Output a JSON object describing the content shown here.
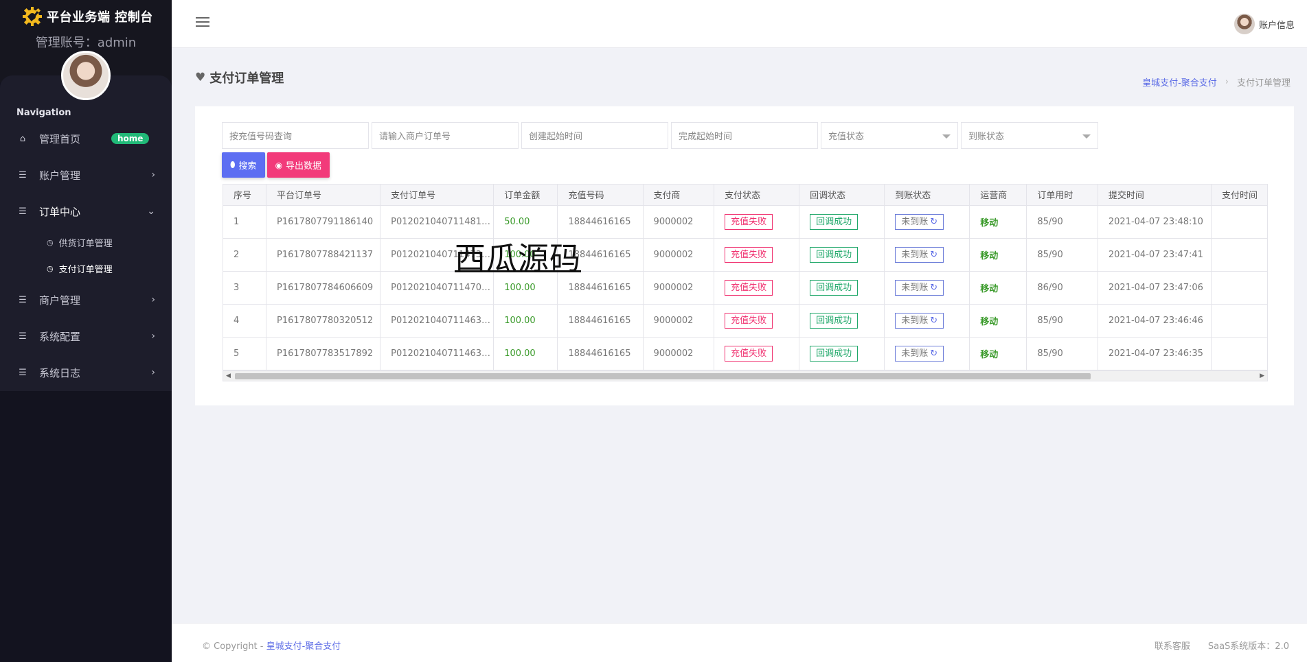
{
  "app": {
    "title": "平台业务端 控制台",
    "admin_line": "管理账号：admin"
  },
  "sidebar": {
    "nav_title": "Navigation",
    "items": [
      {
        "label": "管理首页",
        "icon": "home-icon",
        "badge": "home"
      },
      {
        "label": "账户管理",
        "icon": "list-icon"
      },
      {
        "label": "订单中心",
        "icon": "list-icon",
        "expanded": true
      },
      {
        "label": "商户管理",
        "icon": "list-icon"
      },
      {
        "label": "系统配置",
        "icon": "list-icon"
      },
      {
        "label": "系统日志",
        "icon": "list-icon"
      }
    ],
    "sub_items": [
      {
        "label": "供货订单管理",
        "icon": "clock-icon"
      },
      {
        "label": "支付订单管理",
        "icon": "clock-icon",
        "active": true
      }
    ]
  },
  "topbar": {
    "account_label": "账户信息"
  },
  "page": {
    "title": "支付订单管理",
    "breadcrumb": {
      "link": "皇城支付-聚合支付",
      "separator": "›",
      "current": "支付订单管理"
    }
  },
  "filters": {
    "recharge_number_placeholder": "按充值号码查询",
    "merchant_order_placeholder": "请输入商户订单号",
    "create_time_placeholder": "创建起始时间",
    "finish_time_placeholder": "完成起始时间",
    "recharge_status": "充值状态",
    "arrival_status": "到账状态"
  },
  "buttons": {
    "search": "搜索",
    "export": "导出数据"
  },
  "table": {
    "headers": [
      "序号",
      "平台订单号",
      "支付订单号",
      "订单金额",
      "充值号码",
      "支付商",
      "支付状态",
      "回调状态",
      "到账状态",
      "运营商",
      "订单用时",
      "提交时间",
      "支付时间"
    ],
    "rows": [
      {
        "idx": "1",
        "platform_no": "P1617807791186140",
        "pay_no": "P0120210407114810…",
        "amount": "50.00",
        "phone": "18844616165",
        "provider": "9000002",
        "pay_status": "充值失败",
        "callback": "回调成功",
        "arrival": "未到账",
        "operator": "移动",
        "duration": "85/90",
        "submit_time": "2021-04-07 23:48:10",
        "pay_time": ""
      },
      {
        "idx": "2",
        "platform_no": "P1617807788421137",
        "pay_no": "P0120210407114735…",
        "amount": "100.00",
        "phone": "18844616165",
        "provider": "9000002",
        "pay_status": "充值失败",
        "callback": "回调成功",
        "arrival": "未到账",
        "operator": "移动",
        "duration": "85/90",
        "submit_time": "2021-04-07 23:47:41",
        "pay_time": ""
      },
      {
        "idx": "3",
        "platform_no": "P1617807784606609",
        "pay_no": "P0120210407114706…",
        "amount": "100.00",
        "phone": "18844616165",
        "provider": "9000002",
        "pay_status": "充值失败",
        "callback": "回调成功",
        "arrival": "未到账",
        "operator": "移动",
        "duration": "86/90",
        "submit_time": "2021-04-07 23:47:06",
        "pay_time": ""
      },
      {
        "idx": "4",
        "platform_no": "P1617807780320512",
        "pay_no": "P0120210407114630…",
        "amount": "100.00",
        "phone": "18844616165",
        "provider": "9000002",
        "pay_status": "充值失败",
        "callback": "回调成功",
        "arrival": "未到账",
        "operator": "移动",
        "duration": "85/90",
        "submit_time": "2021-04-07 23:46:46",
        "pay_time": ""
      },
      {
        "idx": "5",
        "platform_no": "P1617807783517892",
        "pay_no": "P0120210407114634…",
        "amount": "100.00",
        "phone": "18844616165",
        "provider": "9000002",
        "pay_status": "充值失败",
        "callback": "回调成功",
        "arrival": "未到账",
        "operator": "移动",
        "duration": "85/90",
        "submit_time": "2021-04-07 23:46:35",
        "pay_time": ""
      }
    ]
  },
  "watermark": "西瓜源码",
  "footer": {
    "copyright_prefix": "© Copyright - ",
    "copyright_link": "皇城支付-聚合支付",
    "contact": "联系客服",
    "version": "SaaS系统版本：2.0"
  },
  "colors": {
    "accent": "#5d6ef2",
    "danger": "#f23a7a",
    "success": "#20a86a",
    "home_badge": "#21b978",
    "sidebar_bg": "#13131f"
  }
}
